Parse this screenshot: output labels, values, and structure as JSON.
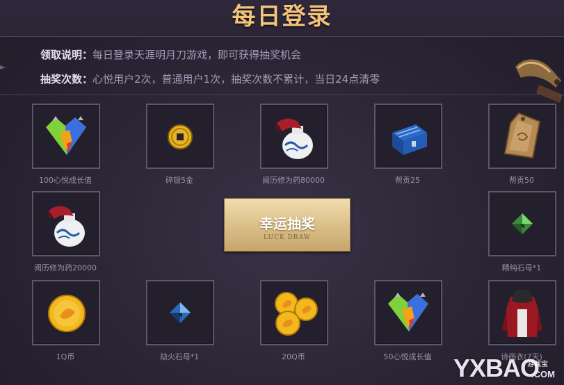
{
  "header": {
    "title": "每日登录"
  },
  "info": {
    "rule_label": "领取说明：",
    "rule_text": "每日登录天涯明月刀游戏，即可获得抽奖机会",
    "count_label": "抽奖次数：",
    "count_text": "心悦用户2次，普通用户1次，抽奖次数不累计，当日24点清零"
  },
  "prizes": [
    {
      "label": "100心悦成长值",
      "icon": "xinyue-gem-icon"
    },
    {
      "label": "碎银5金",
      "icon": "coin-icon"
    },
    {
      "label": "阅历修为药80000",
      "icon": "potion-jar-icon"
    },
    {
      "label": "帮贡25",
      "icon": "chest-icon"
    },
    {
      "label": "帮贡50",
      "icon": "token-icon"
    },
    {
      "label": "阅历修为药20000",
      "icon": "potion-jar-icon"
    },
    {
      "label": "精纯石母*1",
      "icon": "green-crystal-icon"
    },
    {
      "label": "1Q币",
      "icon": "q-coin-icon"
    },
    {
      "label": "劫火石母*1",
      "icon": "blue-crystal-icon"
    },
    {
      "label": "20Q币",
      "icon": "q-coins-icon"
    },
    {
      "label": "50心悦成长值",
      "icon": "xinyue-gem-icon"
    },
    {
      "label": "诗画衣(7天)",
      "icon": "outfit-icon"
    }
  ],
  "draw_button": {
    "label": "幸运抽奖",
    "sub_label": "LUCK DRAW"
  },
  "watermark": {
    "brand": "YXBAO",
    "tag": "游戏宝",
    "domain": ".COM"
  },
  "colors": {
    "title": "#f3c37a",
    "button_gold": "#d9bd86",
    "cell_border": "#5e566c"
  }
}
